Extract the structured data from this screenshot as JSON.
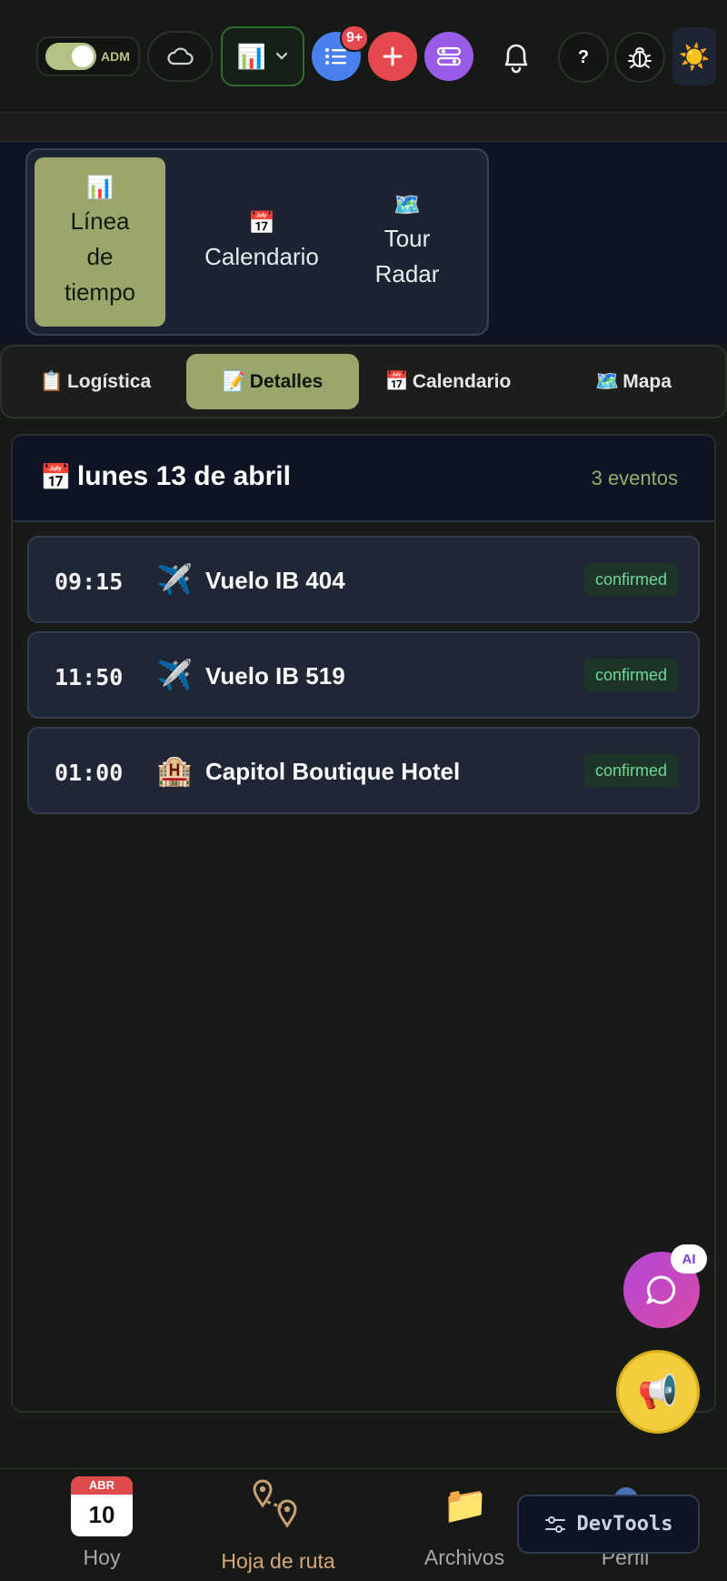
{
  "topbar": {
    "admin_toggle_label": "ADM",
    "notification_badge": "9+",
    "help_label": "?",
    "theme_icon": "☀️",
    "chart_icon": "📊"
  },
  "view_switcher": {
    "options": [
      {
        "icon": "📊",
        "line1": "Línea",
        "line2": "de",
        "line3": "tiempo",
        "active": true
      },
      {
        "icon": "📅",
        "label": "Calendario",
        "active": false
      },
      {
        "icon": "🗺️",
        "line1": "Tour",
        "line2": "Radar",
        "active": false
      }
    ]
  },
  "tabs": [
    {
      "icon": "📋",
      "label": "Logística",
      "active": false
    },
    {
      "icon": "📝",
      "label": "Detalles",
      "active": true
    },
    {
      "icon": "📅",
      "label": "Calendario",
      "active": false
    },
    {
      "icon": "🗺️",
      "label": "Mapa",
      "active": false
    }
  ],
  "day": {
    "icon": "📅",
    "title": "lunes 13 de abril",
    "count": "3 eventos"
  },
  "events": [
    {
      "time": "09:15",
      "icon": "✈️",
      "title": "Vuelo IB 404",
      "status": "confirmed"
    },
    {
      "time": "11:50",
      "icon": "✈️",
      "title": "Vuelo IB 519",
      "status": "confirmed"
    },
    {
      "time": "01:00",
      "icon": "🏨",
      "title": "Capitol Boutique Hotel",
      "status": "confirmed"
    }
  ],
  "floating": {
    "ai_badge": "AI",
    "announce_icon": "📢"
  },
  "bottom_nav": {
    "hoy": {
      "month": "ABR",
      "day": "10",
      "label": "Hoy"
    },
    "ruta": {
      "label": "Hoja de ruta"
    },
    "archivos": {
      "icon": "📁",
      "label": "Archivos"
    },
    "perfil": {
      "label": "Perfil"
    }
  },
  "devtools": {
    "label": "DevTools"
  },
  "colors": {
    "accent": "#9aa66b",
    "status_confirmed": "#6fd99a",
    "header_bg": "#0e1424",
    "card_bg": "#1f2737"
  }
}
